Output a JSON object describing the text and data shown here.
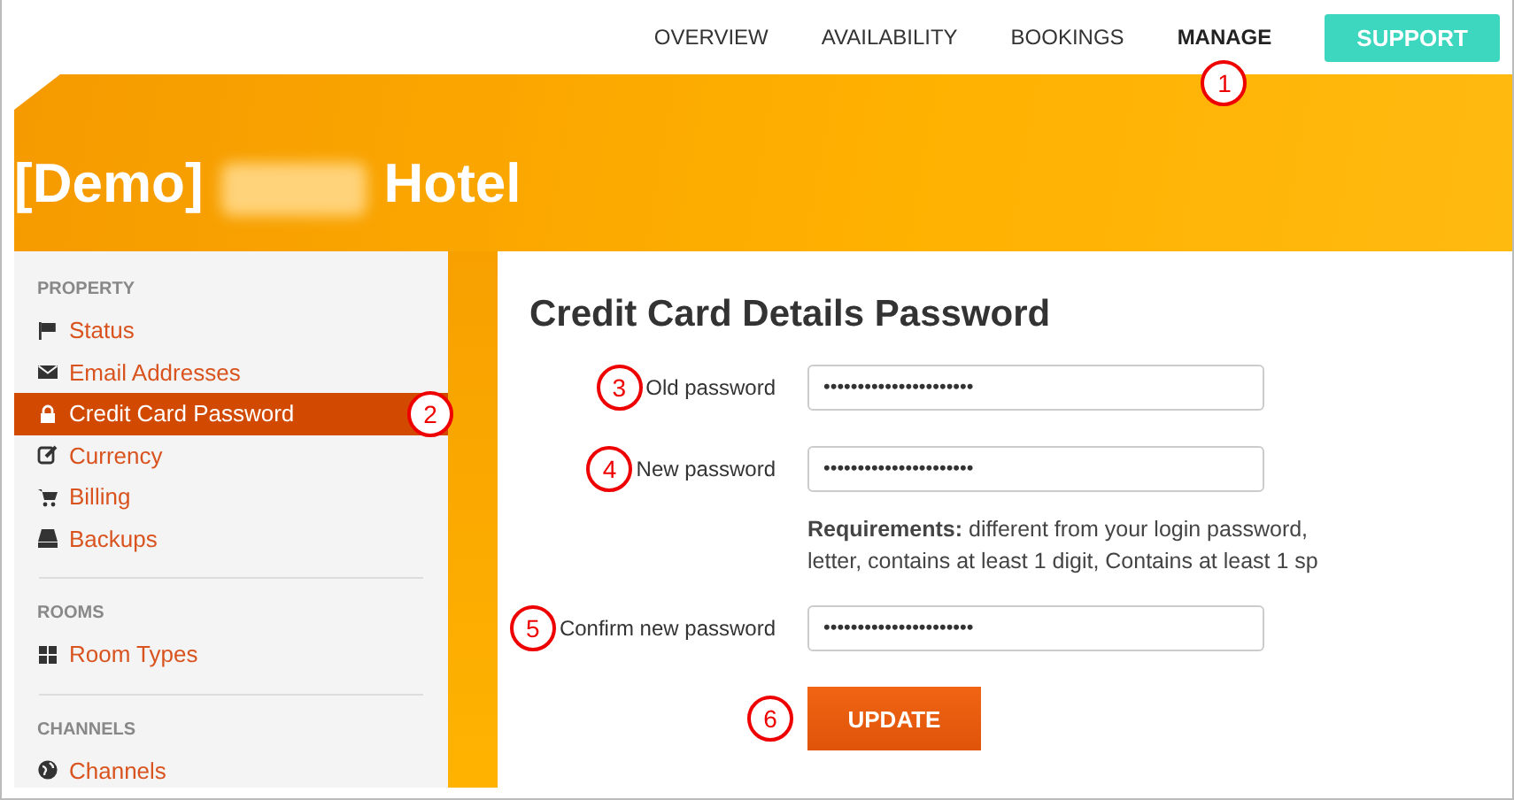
{
  "nav": {
    "items": [
      {
        "label": "OVERVIEW",
        "selected": false
      },
      {
        "label": "AVAILABILITY",
        "selected": false
      },
      {
        "label": "BOOKINGS",
        "selected": false
      },
      {
        "label": "MANAGE",
        "selected": true,
        "callout": "1"
      }
    ],
    "support_button": "SUPPORT"
  },
  "banner": {
    "title_prefix": "[Demo]",
    "title_suffix": "Hotel"
  },
  "sidebar": {
    "sections": [
      {
        "heading": "PROPERTY",
        "items": [
          {
            "label": "Status",
            "selected": false
          },
          {
            "label": "Email Addresses",
            "selected": false
          },
          {
            "label": "Credit Card Password",
            "selected": true,
            "callout": "2"
          },
          {
            "label": "Currency",
            "selected": false
          },
          {
            "label": "Billing",
            "selected": false
          },
          {
            "label": "Backups",
            "selected": false
          }
        ]
      },
      {
        "heading": "ROOMS",
        "items": [
          {
            "label": "Room Types",
            "selected": false
          }
        ]
      },
      {
        "heading": "CHANNELS",
        "items": [
          {
            "label": "Channels",
            "selected": false
          }
        ]
      }
    ]
  },
  "form": {
    "title": "Credit Card Details Password",
    "fields": [
      {
        "label": "Old password",
        "value": "••••••••••••••••••••••",
        "callout": "3"
      },
      {
        "label": "New password",
        "value": "••••••••••••••••••••••",
        "callout": "4",
        "help": [
          "**Requirements:** different from your login password,",
          "letter, contains at least 1 digit, Contains at least 1 sp"
        ]
      },
      {
        "label": "Confirm new password",
        "value": "••••••••••••••••••••••",
        "callout": "5"
      }
    ],
    "button": {
      "label": "UPDATE",
      "callout": "6"
    }
  }
}
